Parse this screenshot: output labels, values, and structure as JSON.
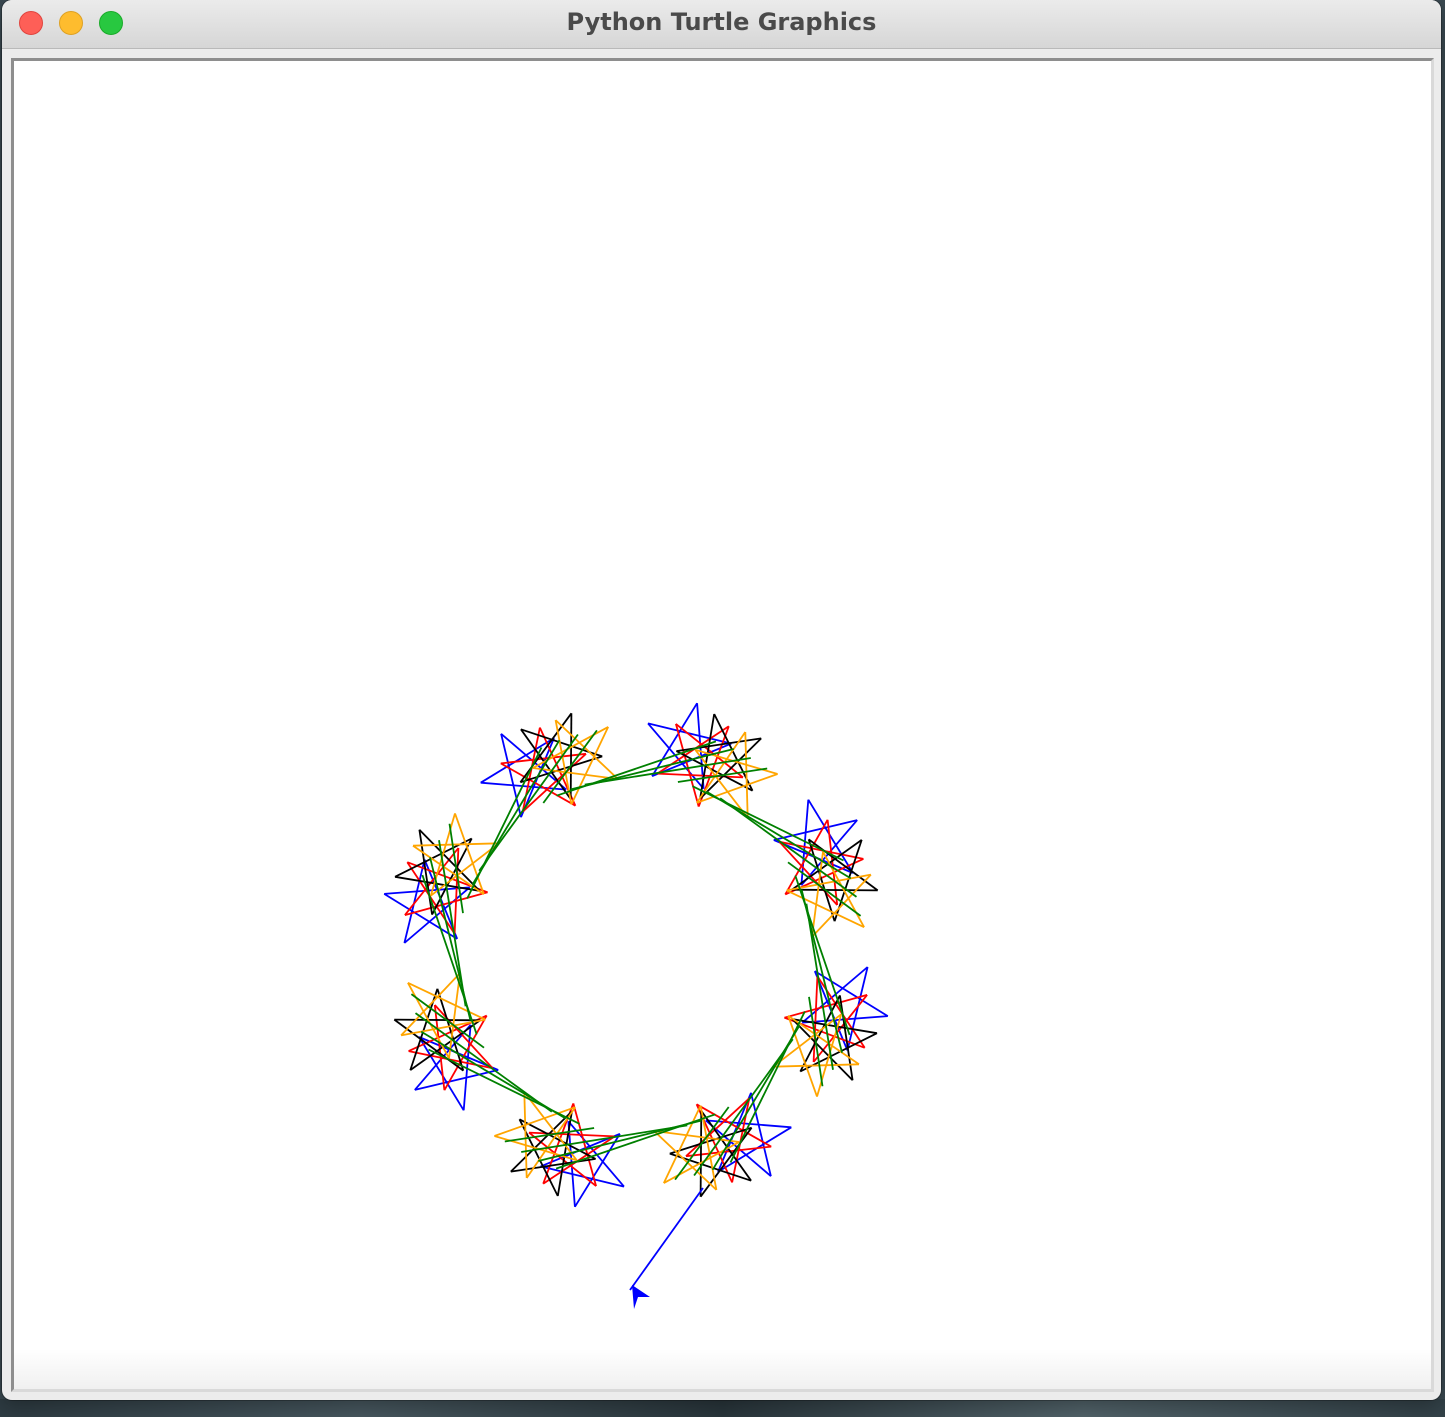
{
  "window": {
    "title": "Python Turtle Graphics"
  },
  "colors": {
    "pen_colors": [
      "#0000ff",
      "#ff0000",
      "#000000",
      "#ffa500",
      "#008000"
    ],
    "turtle": "#0000ff",
    "close": "#fe5f57",
    "minimize": "#febc2e",
    "zoom": "#28c840"
  },
  "icons": {
    "close": "close-icon",
    "minimize": "minimize-icon",
    "zoom": "zoom-icon",
    "turtle": "turtle-arrow-icon"
  }
}
